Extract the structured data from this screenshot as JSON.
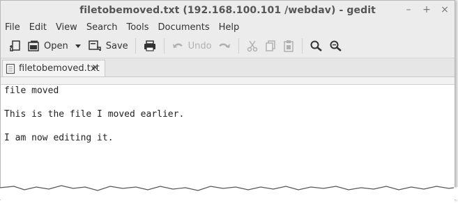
{
  "window": {
    "title": "filetobemoved.txt (192.168.100.101 /webdav) - gedit",
    "controls": [
      "–",
      "+",
      "×"
    ]
  },
  "menu": [
    "File",
    "Edit",
    "View",
    "Search",
    "Tools",
    "Documents",
    "Help"
  ],
  "toolbar": {
    "open_label": "Open",
    "save_label": "Save",
    "undo_label": "Undo"
  },
  "tab": {
    "label": "filetobemoved.txt",
    "close": "×"
  },
  "editor": {
    "lines": [
      "file moved",
      "",
      "This is the file I moved earlier.",
      "",
      "I am now editing it."
    ]
  }
}
